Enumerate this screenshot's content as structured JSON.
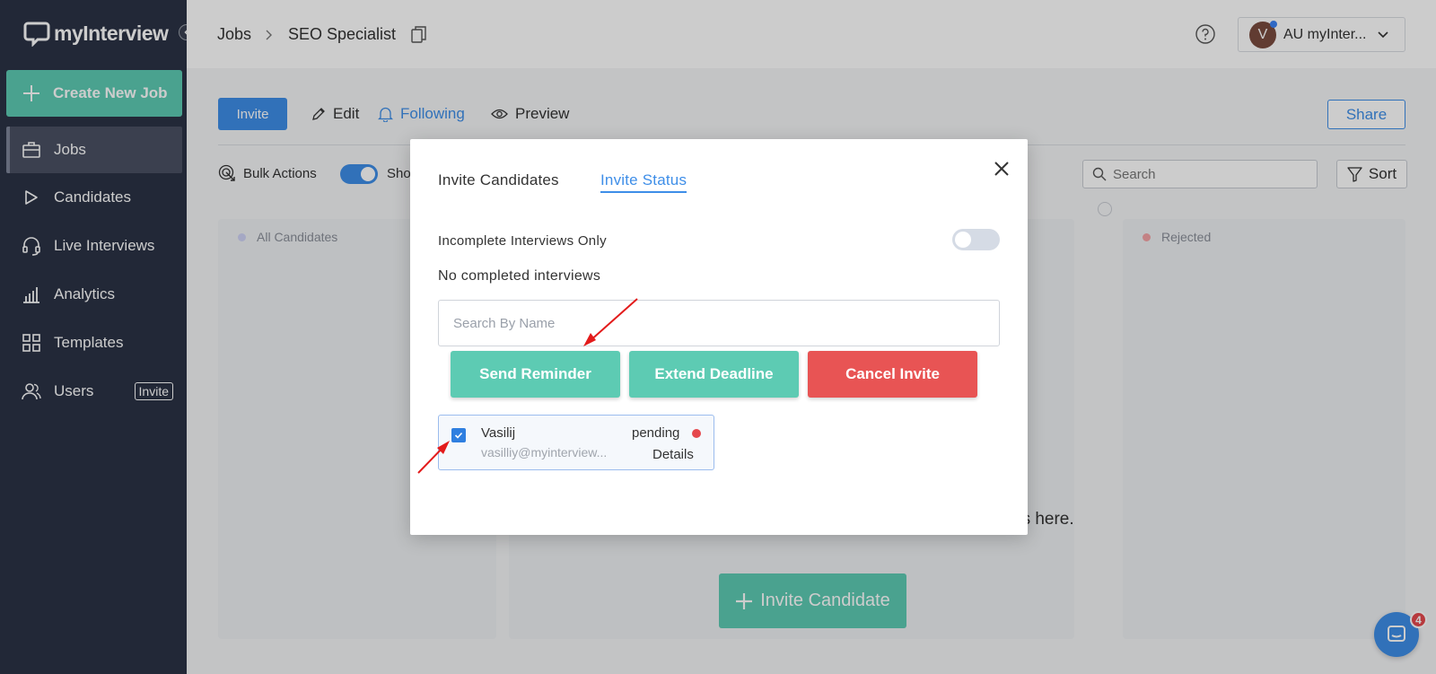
{
  "brand": {
    "name": "myInterview"
  },
  "sidebar": {
    "create_label": "Create New Job",
    "items": [
      {
        "label": "Jobs",
        "icon": "briefcase-icon"
      },
      {
        "label": "Candidates",
        "icon": "play-icon"
      },
      {
        "label": "Live Interviews",
        "icon": "headset-icon"
      },
      {
        "label": "Analytics",
        "icon": "bar-chart-icon"
      },
      {
        "label": "Templates",
        "icon": "grid-icon"
      },
      {
        "label": "Users",
        "icon": "users-icon",
        "badge": "Invite"
      }
    ]
  },
  "header": {
    "breadcrumb_root": "Jobs",
    "breadcrumb_current": "SEO Specialist",
    "account_avatar": "V",
    "account_label": "AU myInter..."
  },
  "toolbar": {
    "invite_label": "Invite",
    "edit_label": "Edit",
    "following_label": "Following",
    "preview_label": "Preview",
    "share_label": "Share",
    "bulk_label": "Bulk Actions",
    "show_label": "Sho",
    "search_placeholder": "Search",
    "sort_label": "Sort"
  },
  "board": {
    "columns": [
      {
        "label": "All Candidates",
        "dot_color": "#cfd3f5"
      },
      {
        "label": "Rejected",
        "dot_color": "#f4a3a6"
      }
    ],
    "empty_hint": "ps here.",
    "invite_candidate_label": "Invite Candidate"
  },
  "chat": {
    "badge": "4"
  },
  "modal": {
    "tabs": [
      {
        "label": "Invite Candidates",
        "active": false
      },
      {
        "label": "Invite Status",
        "active": true
      }
    ],
    "incomplete_label": "Incomplete Interviews Only",
    "incomplete_enabled": false,
    "no_completed_text": "No completed interviews",
    "search_placeholder": "Search By Name",
    "send_reminder_label": "Send Reminder",
    "extend_deadline_label": "Extend Deadline",
    "cancel_invite_label": "Cancel Invite",
    "candidate": {
      "name": "Vasilij",
      "email": "vasilliy@myinterview...",
      "status": "pending",
      "details_label": "Details",
      "checked": true
    }
  },
  "colors": {
    "sidebar_bg": "#2b3245",
    "accent_teal": "#5dcbb3",
    "accent_blue": "#3e8ee8",
    "danger_red": "#e85454",
    "annotation_red": "#e31b1b"
  }
}
